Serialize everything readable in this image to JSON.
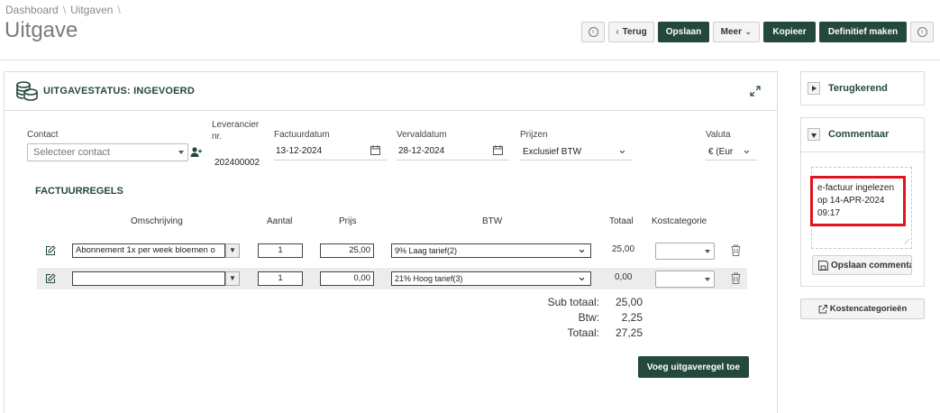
{
  "breadcrumb": {
    "items": [
      "Dashboard",
      "Uitgaven"
    ],
    "sep": "\\"
  },
  "page_title": "Uitgave",
  "toolbar": {
    "terug": "Terug",
    "opslaan": "Opslaan",
    "meer": "Meer",
    "kopieer": "Kopieer",
    "definitief": "Definitief maken"
  },
  "panel": {
    "title": "UITGAVESTATUS: INGEVOERD"
  },
  "form": {
    "contact_label": "Contact",
    "contact_placeholder": "Selecteer contact",
    "leverancier_label_1": "Leverancier",
    "leverancier_label_2": "nr.",
    "leverancier_value": "202400002",
    "factuurdatum_label": "Factuurdatum",
    "factuurdatum_value": "13-12-2024",
    "vervaldatum_label": "Vervaldatum",
    "vervaldatum_value": "28-12-2024",
    "prijzen_label": "Prijzen",
    "prijzen_value": "Exclusief BTW",
    "valuta_label": "Valuta",
    "valuta_value": "€ (Eur"
  },
  "factuurregels": {
    "title": "FACTUURREGELS",
    "headers": {
      "omschrijving": "Omschrijving",
      "aantal": "Aantal",
      "prijs": "Prijs",
      "btw": "BTW",
      "totaal": "Totaal",
      "kostcategorie": "Kostcategorie"
    },
    "rows": [
      {
        "omschrijving": "Abonnement 1x per week bloemen o",
        "aantal": "1",
        "prijs": "25,00",
        "btw": "9% Laag tarief(2)",
        "totaal": "25,00"
      },
      {
        "omschrijving": "",
        "aantal": "1",
        "prijs": "0,00",
        "btw": "21% Hoog tarief(3)",
        "totaal": "0,00"
      }
    ],
    "sub_totaal_label": "Sub totaal:",
    "sub_totaal": "25,00",
    "btw_label": "Btw:",
    "btw": "2,25",
    "totaal_label": "Totaal:",
    "totaal": "27,25",
    "add_button": "Voeg uitgaveregel toe"
  },
  "sidebar": {
    "terugkerend": "Terugkerend",
    "commentaar": "Commentaar",
    "comment_lines": [
      "e-factuur ingelezen",
      "op 14-APR-2024",
      "09:17"
    ],
    "save_comment": "Opslaan commenta",
    "kostencategorieen": "Kostencategorieën"
  },
  "colors": {
    "brand": "#24483a",
    "highlight": "#e0141e"
  }
}
